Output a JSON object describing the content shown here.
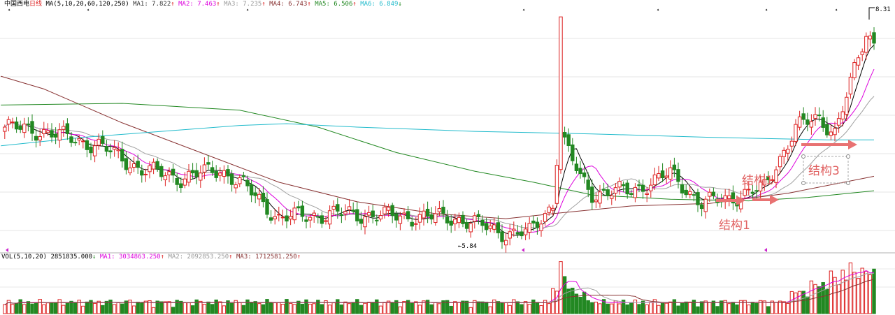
{
  "chart_data": [
    {
      "type": "candlestick",
      "header": {
        "name": "中国西电",
        "period": "日线",
        "indicator": "MA(5,10,20,60,120,250)",
        "ma": [
          {
            "label": "MA1:",
            "value": "7.822",
            "arrow": "↑",
            "color": "#333333"
          },
          {
            "label": "MA2:",
            "value": "7.463",
            "arrow": "↑",
            "color": "#dd00dd"
          },
          {
            "label": "MA3:",
            "value": "7.235",
            "arrow": "↑",
            "color": "#999999"
          },
          {
            "label": "MA4:",
            "value": "6.743",
            "arrow": "↑",
            "color": "#883333"
          },
          {
            "label": "MA5:",
            "value": "6.506",
            "arrow": "↑",
            "color": "#228822"
          },
          {
            "label": "MA6:",
            "value": "6.849",
            "arrow": "↓",
            "color": "#22bbcc"
          }
        ]
      },
      "price_range": [
        5.6,
        8.4
      ],
      "high_label": "8.31",
      "low_label": "5.84",
      "colors": {
        "up": "#dd2222",
        "down": "#228822",
        "ma5": "#000000",
        "ma10": "#dd00dd",
        "ma20": "#a0a0a0",
        "ma60": "#883333",
        "ma120": "#228822",
        "ma250": "#22bbcc"
      },
      "annotations": [
        {
          "text": "结构1"
        },
        {
          "text": "结构1"
        },
        {
          "text": "结构3"
        }
      ]
    },
    {
      "type": "bar",
      "header": {
        "indicator": "VOL(5,10,20)",
        "value": "2851835.000",
        "arrow": "↓",
        "ma": [
          {
            "label": "MA1:",
            "value": "3034863.250",
            "arrow": "↑",
            "color": "#dd00dd"
          },
          {
            "label": "MA2:",
            "value": "2092853.250",
            "arrow": "↑",
            "color": "#999999"
          },
          {
            "label": "MA3:",
            "value": "1712581.250",
            "arrow": "↑",
            "color": "#883333"
          }
        ]
      }
    }
  ]
}
